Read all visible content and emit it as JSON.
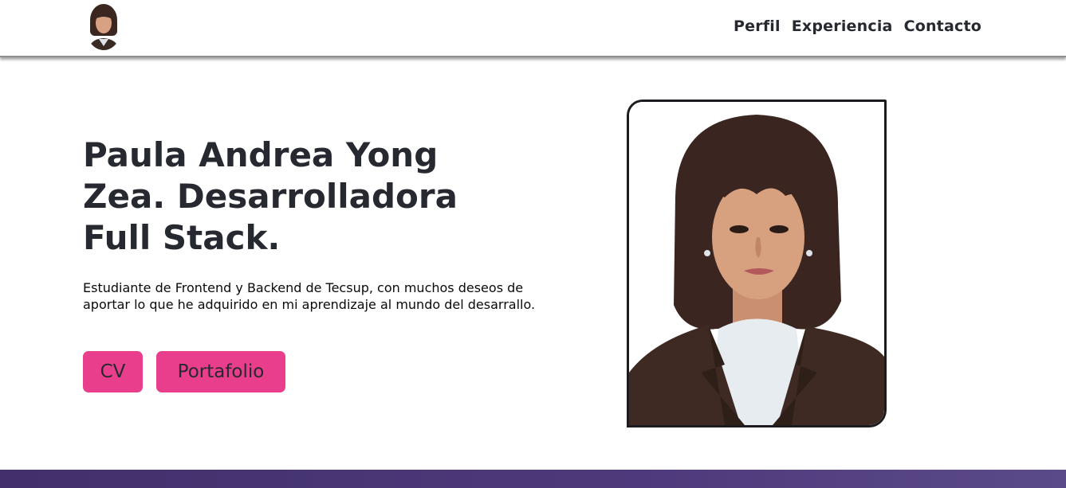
{
  "nav": {
    "links": [
      "Perfil",
      "Experiencia",
      "Contacto"
    ]
  },
  "hero": {
    "title_line1": "Paula Andrea Yong Zea.",
    "title_line2": "Desarrolladora Full Stack.",
    "description": "Estudiante de Frontend y Backend de Tecsup, con muchos deseos de aportar lo que he adquirido en mi aprendizaje al mundo del desarrallo.",
    "buttons": {
      "cv": "CV",
      "portfolio": "Portafolio"
    }
  },
  "colors": {
    "accent": "#e83e8c",
    "text": "#272930",
    "footer": "#41306b"
  }
}
